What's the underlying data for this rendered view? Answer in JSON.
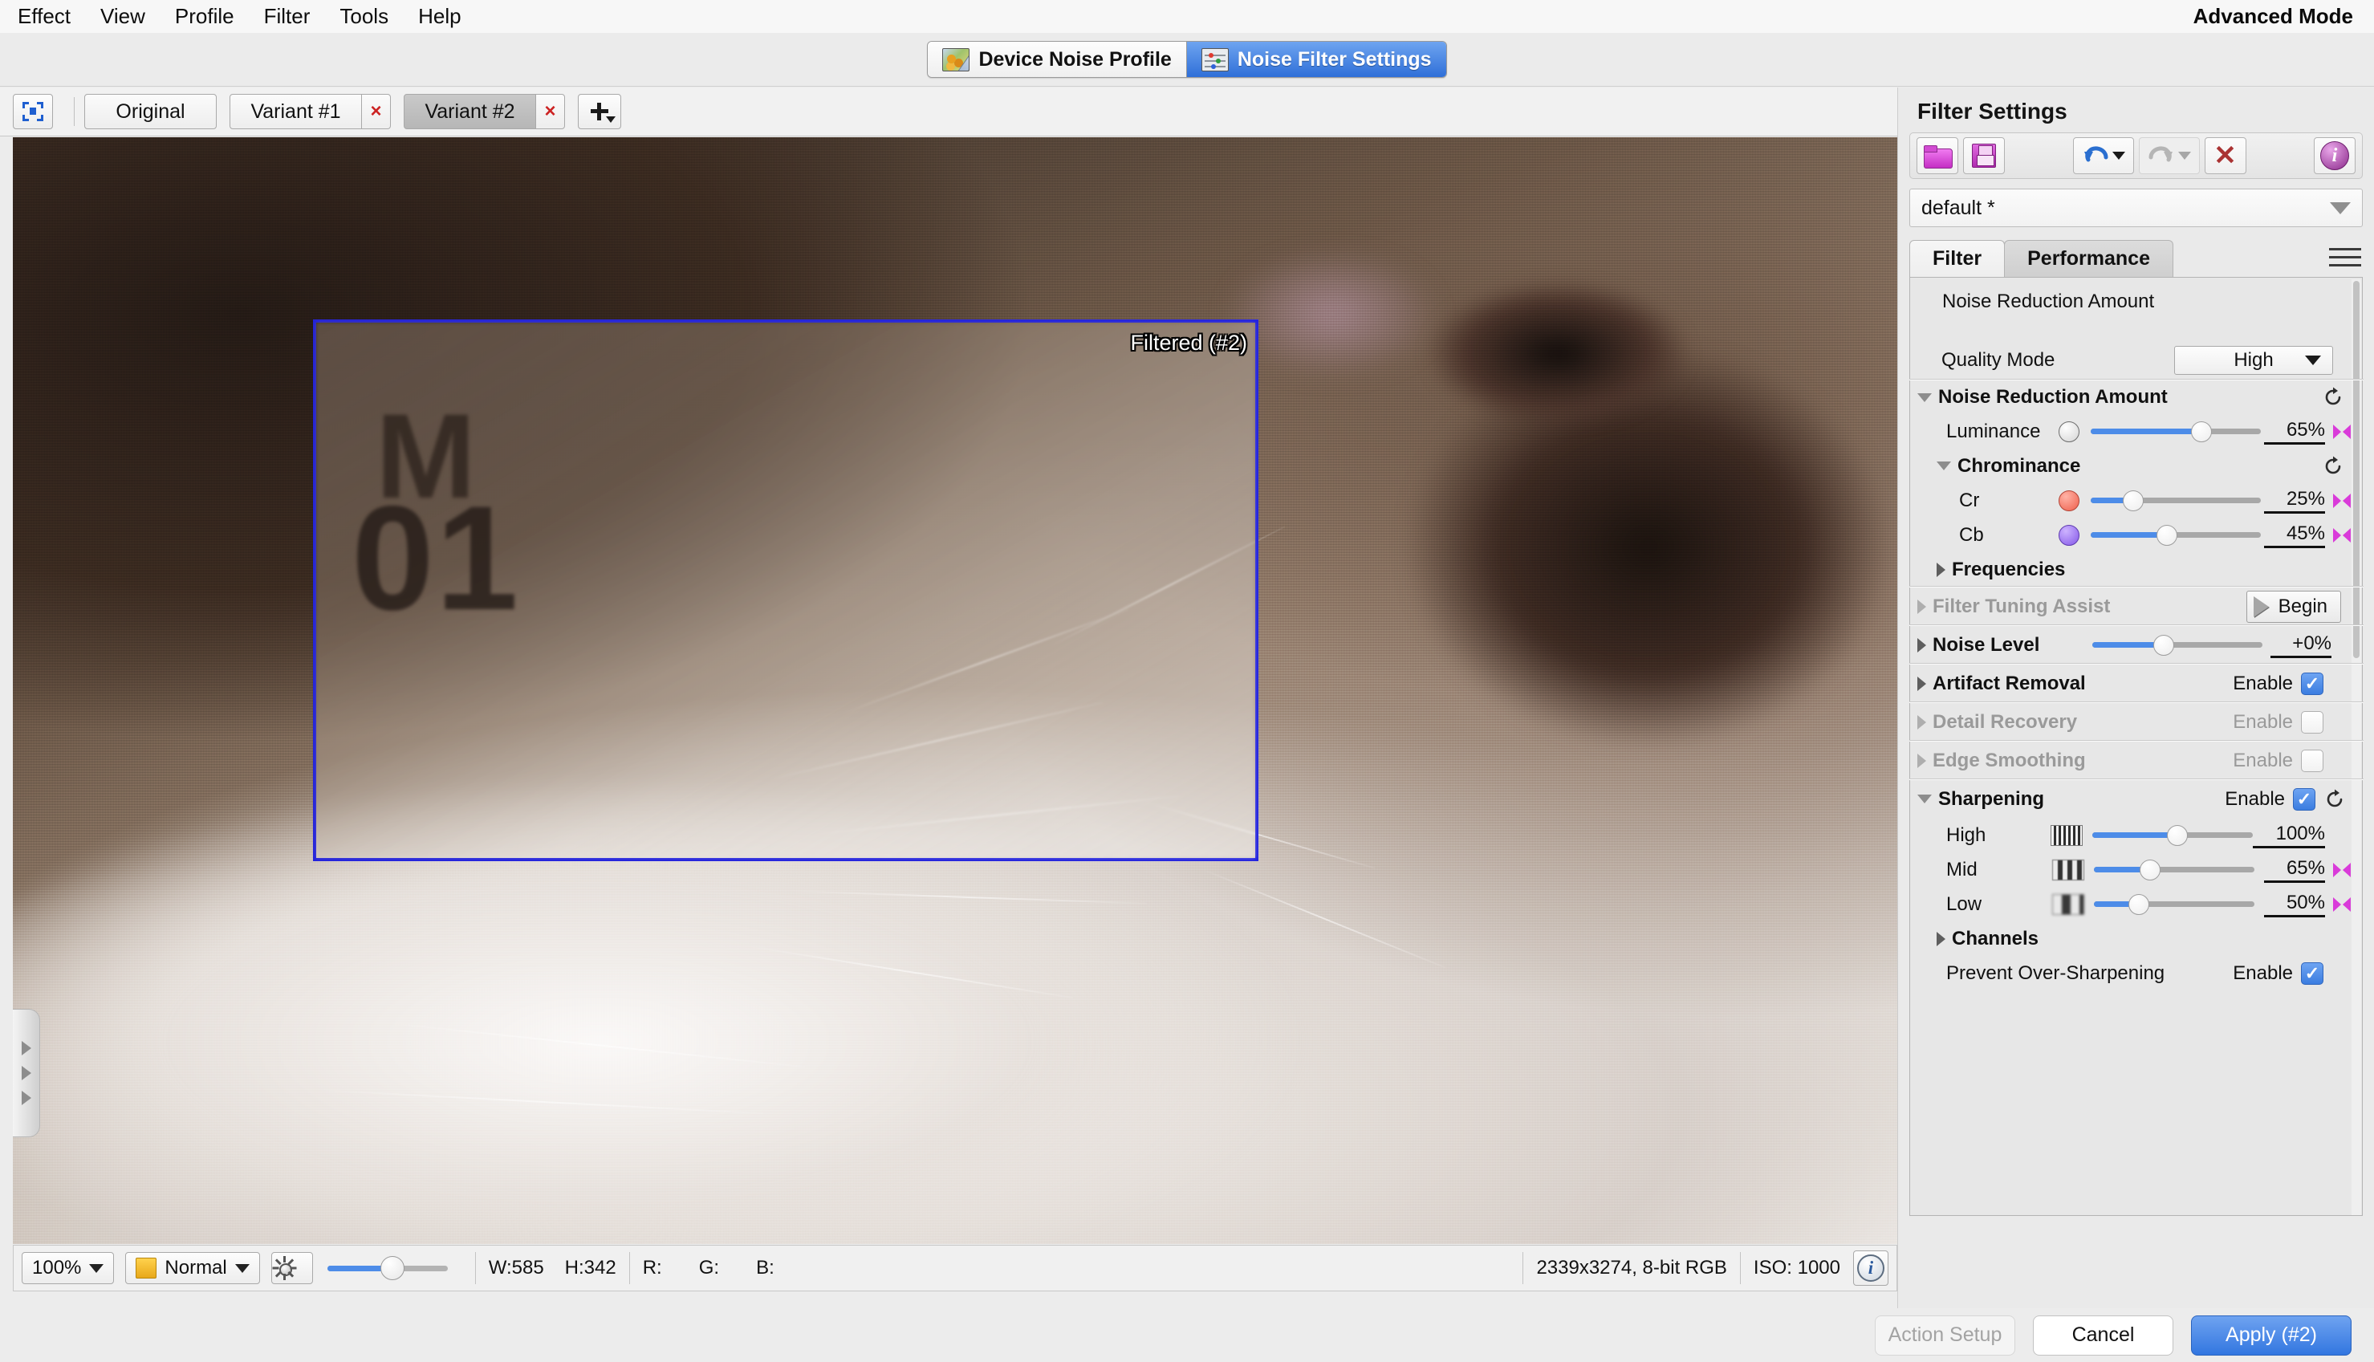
{
  "menubar": {
    "items": [
      "Effect",
      "View",
      "Profile",
      "Filter",
      "Tools",
      "Help"
    ],
    "mode_label": "Advanced Mode"
  },
  "segmented_tabs": [
    {
      "label": "Device Noise Profile",
      "icon": "noise-profile-icon",
      "active": false
    },
    {
      "label": "Noise Filter Settings",
      "icon": "sliders-icon",
      "active": true
    }
  ],
  "variant_bar": {
    "select_icon": "select-region-icon",
    "tabs": [
      {
        "label": "Original",
        "closable": false,
        "active": false
      },
      {
        "label": "Variant #1",
        "closable": true,
        "active": false
      },
      {
        "label": "Variant #2",
        "closable": true,
        "active": true
      }
    ],
    "close_glyph": "×",
    "add_label": "add-variant-icon"
  },
  "canvas": {
    "overlay_label": "Filtered (#2)",
    "plate_text_top": "M",
    "plate_text_main": "01",
    "collapse_handle": "panel-collapse-handle"
  },
  "statusbar": {
    "zoom": "100%",
    "blend_mode": "Normal",
    "brightness_icon": "brightness-icon",
    "width_label": "W:585",
    "height_label": "H:342",
    "r_label": "R:",
    "g_label": "G:",
    "b_label": "B:",
    "r_value": "",
    "g_value": "",
    "b_value": "",
    "image_info": "2339x3274, 8-bit RGB",
    "iso": "ISO: 1000",
    "info_glyph": "i"
  },
  "panel": {
    "title": "Filter Settings",
    "toolbar": [
      {
        "name": "open-preset-button",
        "icon": "folder-icon",
        "disabled": false
      },
      {
        "name": "save-preset-button",
        "icon": "floppy-save-icon",
        "disabled": false
      },
      {
        "name": "undo-button",
        "icon": "undo-arrow-icon",
        "disabled": false
      },
      {
        "name": "redo-button",
        "icon": "redo-arrow-icon",
        "disabled": true
      },
      {
        "name": "delete-preset-button",
        "icon": "red-x-icon",
        "disabled": false
      },
      {
        "name": "info-button",
        "icon": "info-circle-icon",
        "disabled": false
      }
    ],
    "preset": {
      "value": "default *",
      "caret": "chevron-down-icon"
    },
    "tabs": [
      {
        "label": "Filter",
        "active": true
      },
      {
        "label": "Performance",
        "active": false
      }
    ],
    "menu_icon": "hamburger-menu-icon",
    "quality_mode": {
      "label": "Quality Mode",
      "value": "High"
    },
    "sections": {
      "noise_reduction": {
        "label": "Noise Reduction Amount",
        "expanded": true,
        "sliders": [
          {
            "label": "Luminance",
            "value": "65%",
            "pct": 65,
            "swatch": "white"
          }
        ],
        "chrominance": {
          "label": "Chrominance",
          "expanded": true,
          "sliders": [
            {
              "label": "Cr",
              "value": "25%",
              "pct": 25,
              "swatch": "red"
            },
            {
              "label": "Cb",
              "value": "45%",
              "pct": 45,
              "swatch": "purple"
            }
          ]
        },
        "frequencies": {
          "label": "Frequencies",
          "expanded": false
        }
      },
      "filter_tuning_assist": {
        "label": "Filter Tuning Assist",
        "disabled": true,
        "button": "Begin"
      },
      "noise_level": {
        "label": "Noise Level",
        "value": "+0%",
        "pct": 42
      },
      "artifact_removal": {
        "label": "Artifact Removal",
        "enable_label": "Enable",
        "checked": true,
        "disabled": false
      },
      "detail_recovery": {
        "label": "Detail Recovery",
        "enable_label": "Enable",
        "checked": false,
        "disabled": true
      },
      "edge_smoothing": {
        "label": "Edge Smoothing",
        "enable_label": "Enable",
        "checked": false,
        "disabled": true
      },
      "sharpening": {
        "label": "Sharpening",
        "enable_label": "Enable",
        "checked": true,
        "expanded": true,
        "sliders": [
          {
            "label": "High",
            "value": "100%",
            "pct": 53,
            "thumb": "hi",
            "bowtie": false
          },
          {
            "label": "Mid",
            "value": "65%",
            "pct": 35,
            "thumb": "mid",
            "bowtie": true
          },
          {
            "label": "Low",
            "value": "50%",
            "pct": 28,
            "thumb": "low",
            "bowtie": true
          }
        ],
        "channels": {
          "label": "Channels",
          "expanded": false
        },
        "prevent_over_sharpening": {
          "label": "Prevent Over-Sharpening",
          "enable_label": "Enable",
          "checked": true
        }
      }
    }
  },
  "actions": [
    {
      "label": "Action Setup",
      "style": "disabled"
    },
    {
      "label": "Cancel",
      "style": "secondary"
    },
    {
      "label": "Apply (#2)",
      "style": "primary"
    }
  ],
  "colors": {
    "accent_blue": "#3276e0",
    "slider_fill": "#4d8ce8",
    "selection_box": "#2222dd",
    "magenta": "#dd33dd",
    "danger_red": "#a33333"
  }
}
